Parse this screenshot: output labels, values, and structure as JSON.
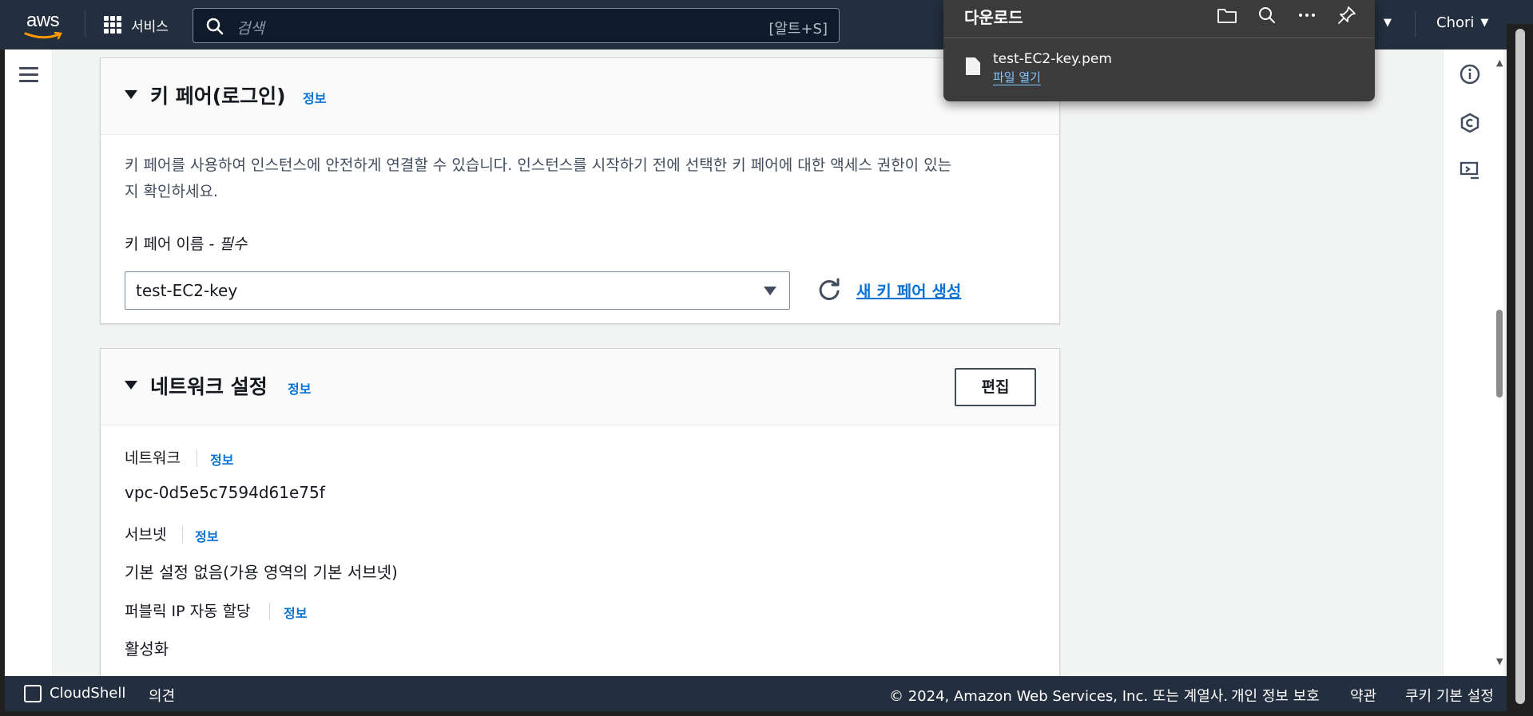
{
  "nav": {
    "logo_text": "aws",
    "services_label": "서비스",
    "search_placeholder": "검색",
    "search_shortcut": "[알트+S]",
    "user_label": "Chori",
    "brand_color": "#232f3e"
  },
  "downloads": {
    "title": "다운로드",
    "file_name": "test-EC2-key.pem",
    "open_file_label": "파일 열기",
    "icons": [
      "folder-icon",
      "search-icon",
      "more-icon",
      "pin-icon"
    ]
  },
  "key_pair": {
    "title": "키 페어(로그인)",
    "info_label": "정보",
    "description_line1": "키 페어를 사용하여 인스턴스에 안전하게 연결할 수 있습니다. 인스턴스를 시작하기 전에 선택한 키 페어에 대한 액세스 권한이 있는",
    "description_line2": "지 확인하세요.",
    "field_label": "키 페어 이름 - ",
    "field_required": "필수",
    "selected_value": "test-EC2-key",
    "create_link": "새 키 페어 생성"
  },
  "network": {
    "title": "네트워크 설정",
    "info_label": "정보",
    "edit_label": "편집",
    "network_label": "네트워크",
    "network_info": "정보",
    "network_value": "vpc-0d5e5c7594d61e75f",
    "subnet_label": "서브넷",
    "subnet_info": "정보",
    "subnet_value": "기본 설정 없음(가용 영역의 기본 서브넷)",
    "public_ip_label": "퍼블릭 IP 자동 할당",
    "public_ip_info": "정보",
    "public_ip_value": "활성화"
  },
  "footer": {
    "cloudshell_label": "CloudShell",
    "feedback_label": "의견",
    "copyright": "© 2024, Amazon Web Services, Inc. 또는 계열사.",
    "privacy_label": "개인 정보 보호",
    "terms_label": "약관",
    "cookie_label": "쿠키 기본 설정"
  }
}
